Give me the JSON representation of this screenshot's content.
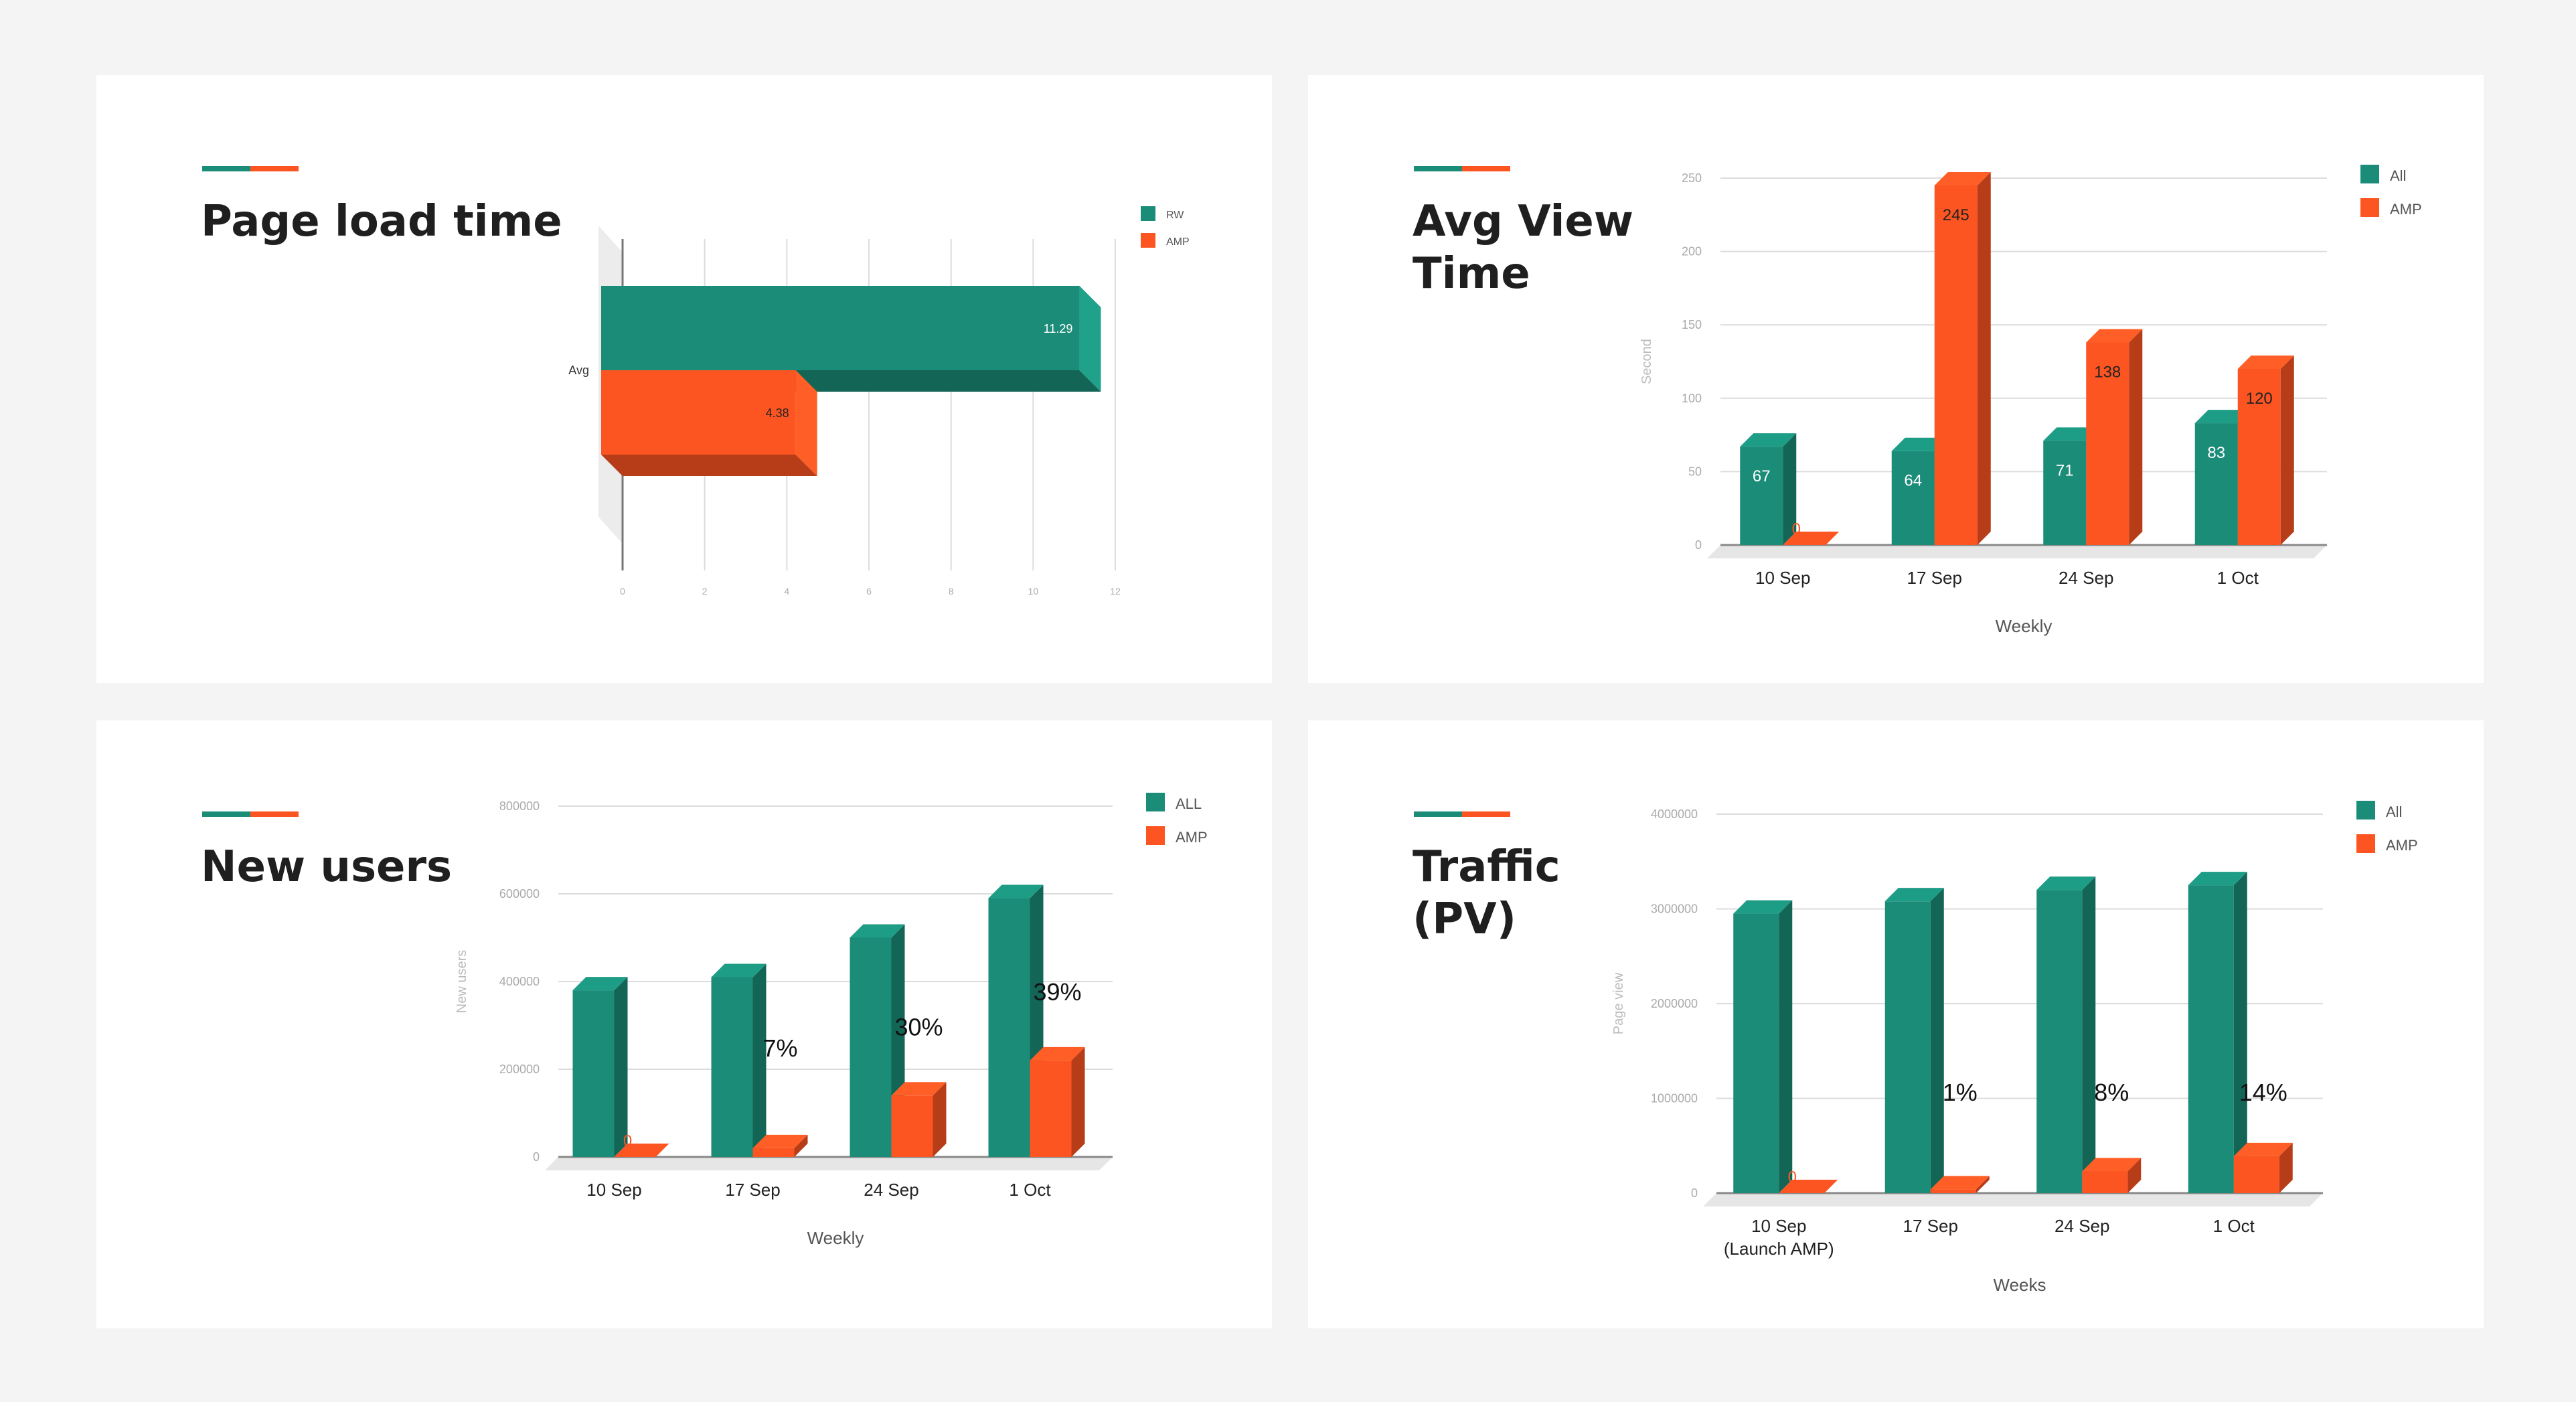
{
  "colors": {
    "all": "#1b8c78",
    "amp": "#fd5522",
    "accent_teal": "#1b8c78",
    "accent_orange": "#fd5522"
  },
  "panels": {
    "page_load": {
      "title": "Page load time"
    },
    "avg_view": {
      "title": "Avg View\nTime"
    },
    "new_users": {
      "title": "New users"
    },
    "traffic": {
      "title": "Traffic\n(PV)"
    }
  },
  "chart_data": [
    {
      "type": "bar",
      "orientation": "horizontal",
      "categories": [
        "Avg"
      ],
      "series": [
        {
          "name": "RW",
          "values": [
            11.29
          ]
        },
        {
          "name": "AMP",
          "values": [
            4.38
          ]
        }
      ],
      "value_labels": [
        "11.29",
        "4.38"
      ],
      "xticks": [
        "0",
        "2",
        "4",
        "6",
        "8",
        "10",
        "12"
      ],
      "xlim": [
        0,
        12
      ],
      "legend": "top-right",
      "grid": true
    },
    {
      "type": "bar",
      "categories": [
        "10 Sep",
        "17 Sep",
        "24 Sep",
        "1 Oct"
      ],
      "series": [
        {
          "name": "All",
          "values": [
            67,
            64,
            71,
            83
          ]
        },
        {
          "name": "AMP",
          "values": [
            0,
            245,
            138,
            120
          ]
        }
      ],
      "xlabel": "Weekly",
      "ylabel": "Second",
      "yticks": [
        "250",
        "200",
        "150",
        "100",
        "50",
        "0"
      ],
      "ylim": [
        0,
        250
      ],
      "legend": "top-right",
      "grid": true
    },
    {
      "type": "bar",
      "categories": [
        "10 Sep",
        "17 Sep",
        "24 Sep",
        "1 Oct"
      ],
      "series": [
        {
          "name": "ALL",
          "values": [
            380000,
            410000,
            500000,
            590000
          ]
        },
        {
          "name": "AMP",
          "values": [
            0,
            20000,
            140000,
            220000
          ]
        }
      ],
      "annotations": [
        "",
        "7%",
        "30%",
        "39%"
      ],
      "amp_zero_label": "0",
      "xlabel": "Weekly",
      "ylabel": "New users",
      "yticks": [
        "800000",
        "600000",
        "400000",
        "200000",
        "0"
      ],
      "ylim": [
        0,
        800000
      ],
      "legend": "top-right",
      "grid": true
    },
    {
      "type": "bar",
      "categories": [
        "10 Sep\n(Launch AMP)",
        "17 Sep",
        "24 Sep",
        "1 Oct"
      ],
      "series": [
        {
          "name": "All",
          "values": [
            2950000,
            3080000,
            3200000,
            3250000
          ]
        },
        {
          "name": "AMP",
          "values": [
            0,
            40000,
            230000,
            390000
          ]
        }
      ],
      "annotations": [
        "",
        "1%",
        "8%",
        "14%"
      ],
      "amp_zero_label": "0",
      "xlabel": "Weeks",
      "ylabel": "Page view",
      "yticks": [
        "4000000",
        "3000000",
        "2000000",
        "1000000",
        "0"
      ],
      "ylim": [
        0,
        4000000
      ],
      "legend": "top-right",
      "grid": true
    }
  ]
}
